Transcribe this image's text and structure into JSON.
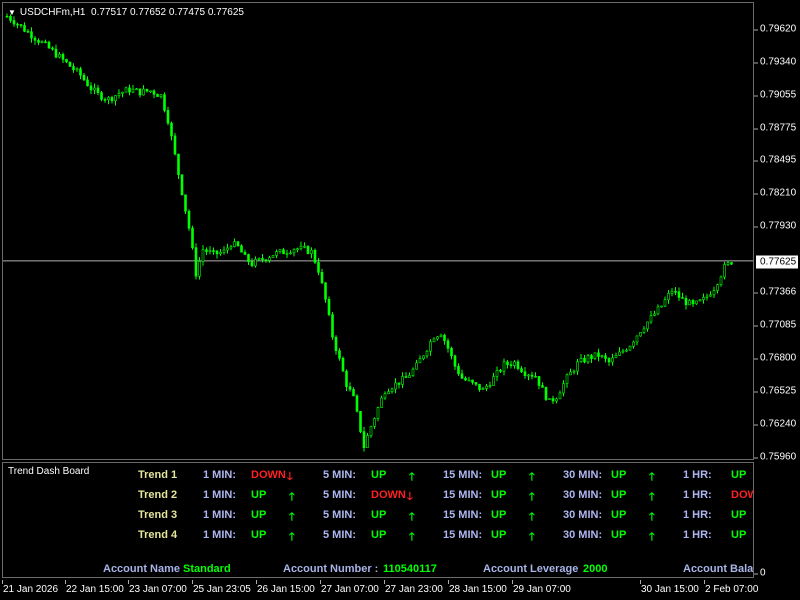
{
  "header": {
    "symbol": "USDCHFm,H1",
    "ohlc": "0.77517 0.77652 0.77475 0.77625"
  },
  "price_axis": {
    "ticks": [
      "0.79620",
      "0.79340",
      "0.79055",
      "0.78775",
      "0.78495",
      "0.78210",
      "0.77930",
      "0.77366",
      "0.77085",
      "0.76800",
      "0.76525",
      "0.76240",
      "0.75960"
    ],
    "current": "0.77625",
    "sub_zero": "0"
  },
  "time_axis": [
    "21 Jan 2026",
    "22 Jan 15:00",
    "23 Jan 07:00",
    "25 Jan 23:05",
    "26 Jan 15:00",
    "27 Jan 07:00",
    "27 Jan 23:00",
    "28 Jan 15:00",
    "29 Jan 07:00",
    "30 Jan 15:00",
    "2 Feb 07:00"
  ],
  "dashboard": {
    "title": "Trend Dash Board",
    "rows": [
      {
        "name": "Trend 1",
        "m1_label": "1 MIN:",
        "m1": "DOWN",
        "m5_label": "5 MIN:",
        "m5": "UP",
        "m15_label": "15 MIN:",
        "m15": "UP",
        "m30_label": "30 MIN:",
        "m30": "UP",
        "h1_label": "1 HR:",
        "h1": "UP"
      },
      {
        "name": "Trend 2",
        "m1_label": "1 MIN:",
        "m1": "UP",
        "m5_label": "5 MIN:",
        "m5": "DOWN",
        "m15_label": "15 MIN:",
        "m15": "UP",
        "m30_label": "30 MIN:",
        "m30": "UP",
        "h1_label": "1 HR:",
        "h1": "DOW"
      },
      {
        "name": "Trend 3",
        "m1_label": "1 MIN:",
        "m1": "UP",
        "m5_label": "5 MIN:",
        "m5": "UP",
        "m15_label": "15 MIN:",
        "m15": "UP",
        "m30_label": "30 MIN:",
        "m30": "UP",
        "h1_label": "1 HR:",
        "h1": "UP"
      },
      {
        "name": "Trend 4",
        "m1_label": "1 MIN:",
        "m1": "UP",
        "m5_label": "5 MIN:",
        "m5": "UP",
        "m15_label": "15 MIN:",
        "m15": "UP",
        "m30_label": "30 MIN:",
        "m30": "UP",
        "h1_label": "1 HR:",
        "h1": "UP"
      }
    ],
    "account": {
      "name_label": "Account Name",
      "name_value": "Standard",
      "number_label": "Account Number :",
      "number_value": "110540117",
      "leverage_label": "Account Leverage",
      "leverage_value": "2000",
      "balance_label": "Account Bala"
    }
  },
  "colors": {
    "candle": "#00ff00",
    "up": "#00ff00",
    "down": "#ff2020",
    "bid_line": "#b0b0b0",
    "grid_border": "#6a6a6a"
  },
  "chart_data": {
    "type": "candlestick",
    "symbol": "USDCHFm",
    "timeframe": "H1",
    "ylim": [
      0.7596,
      0.7977
    ],
    "current_price": 0.77625,
    "close_path": [
      [
        0,
        0.7966
      ],
      [
        2,
        0.7962
      ],
      [
        5,
        0.7955
      ],
      [
        9,
        0.7946
      ],
      [
        13,
        0.7937
      ],
      [
        17,
        0.7927
      ],
      [
        21,
        0.7917
      ],
      [
        24,
        0.7906
      ],
      [
        26,
        0.7901
      ],
      [
        29,
        0.7897
      ],
      [
        32,
        0.7902
      ],
      [
        35,
        0.7905
      ],
      [
        38,
        0.7903
      ],
      [
        41,
        0.7904
      ],
      [
        44,
        0.79
      ],
      [
        46,
        0.788
      ],
      [
        48,
        0.785
      ],
      [
        50,
        0.782
      ],
      [
        52,
        0.779
      ],
      [
        54,
        0.7752
      ],
      [
        56,
        0.7772
      ],
      [
        59,
        0.7768
      ],
      [
        62,
        0.777
      ],
      [
        64,
        0.7777
      ],
      [
        66,
        0.7774
      ],
      [
        68,
        0.7765
      ],
      [
        70,
        0.776
      ],
      [
        73,
        0.7764
      ],
      [
        76,
        0.7768
      ],
      [
        79,
        0.777
      ],
      [
        82,
        0.7773
      ],
      [
        85,
        0.7772
      ],
      [
        87,
        0.777
      ],
      [
        89,
        0.7755
      ],
      [
        91,
        0.773
      ],
      [
        93,
        0.77
      ],
      [
        95,
        0.768
      ],
      [
        97,
        0.766
      ],
      [
        99,
        0.7648
      ],
      [
        101,
        0.7622
      ],
      [
        102,
        0.7608
      ],
      [
        104,
        0.7625
      ],
      [
        106,
        0.764
      ],
      [
        108,
        0.7655
      ],
      [
        111,
        0.766
      ],
      [
        114,
        0.7665
      ],
      [
        117,
        0.7675
      ],
      [
        120,
        0.769
      ],
      [
        122,
        0.77
      ],
      [
        124,
        0.7703
      ],
      [
        126,
        0.769
      ],
      [
        128,
        0.7675
      ],
      [
        130,
        0.7665
      ],
      [
        133,
        0.766
      ],
      [
        136,
        0.7655
      ],
      [
        139,
        0.7665
      ],
      [
        142,
        0.7676
      ],
      [
        145,
        0.7678
      ],
      [
        148,
        0.767
      ],
      [
        151,
        0.7667
      ],
      [
        153,
        0.7655
      ],
      [
        155,
        0.7645
      ],
      [
        157,
        0.765
      ],
      [
        160,
        0.7665
      ],
      [
        163,
        0.7677
      ],
      [
        166,
        0.7682
      ],
      [
        169,
        0.7684
      ],
      [
        172,
        0.7678
      ],
      [
        175,
        0.7685
      ],
      [
        178,
        0.7693
      ],
      [
        181,
        0.7705
      ],
      [
        184,
        0.7715
      ],
      [
        187,
        0.7725
      ],
      [
        190,
        0.7738
      ],
      [
        193,
        0.773
      ],
      [
        196,
        0.7725
      ],
      [
        199,
        0.773
      ],
      [
        202,
        0.774
      ],
      [
        205,
        0.7757
      ],
      [
        207,
        0.7762
      ]
    ]
  }
}
